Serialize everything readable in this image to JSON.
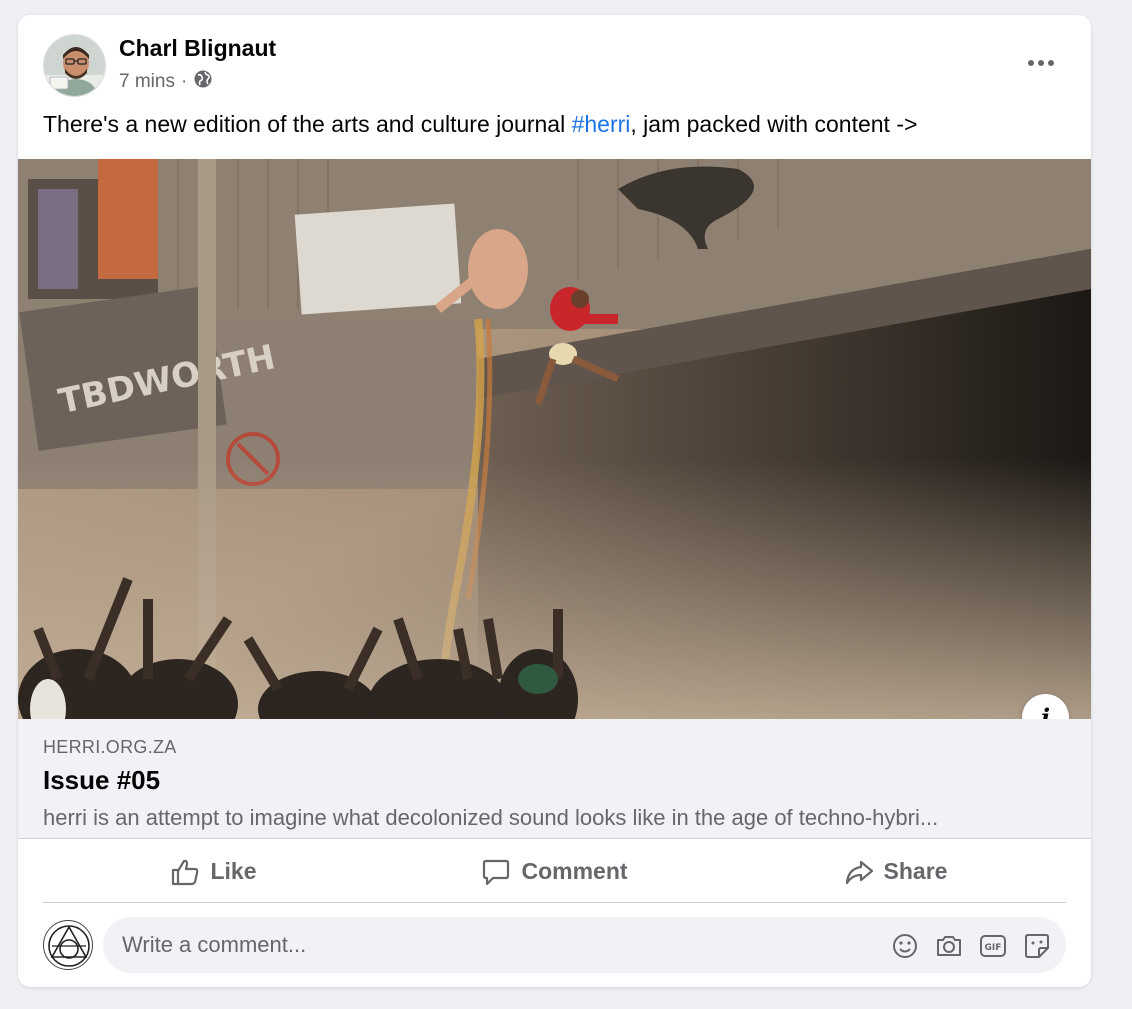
{
  "post": {
    "author": "Charl Blignaut",
    "time": "7 mins",
    "separator": "·",
    "privacy_icon": "globe-icon",
    "text_before": "There's a new edition of the arts and culture journal ",
    "hashtag": "#herri",
    "text_after": ", jam packed with content ->",
    "more_icon": "more-options-icon"
  },
  "image": {
    "sign_text": "TBDWORTH"
  },
  "link": {
    "domain": "HERRI.ORG.ZA",
    "title": "Issue #05",
    "description": "herri is an attempt to imagine what decolonized sound looks like in the age of techno-hybri..."
  },
  "actions": {
    "like": "Like",
    "comment": "Comment",
    "share": "Share"
  },
  "comment_box": {
    "placeholder": "Write a comment...",
    "icons": [
      "emoji-icon",
      "camera-icon",
      "gif-icon",
      "sticker-icon"
    ]
  },
  "colors": {
    "hashtag": "#1b74e4",
    "secondary_text": "#65676b",
    "link_background": "#f0f2f5"
  }
}
